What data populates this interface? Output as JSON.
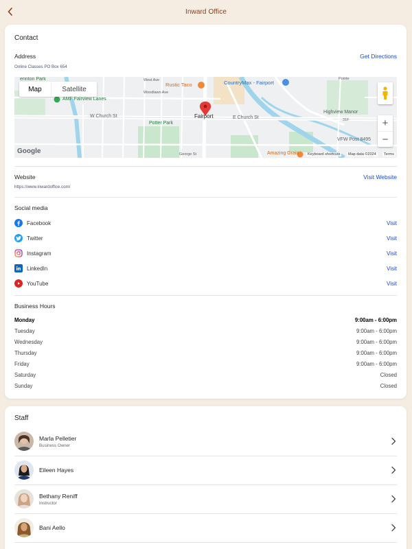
{
  "header": {
    "title": "Inward Office"
  },
  "contact": {
    "title": "Contact",
    "address": {
      "label": "Address",
      "value": "Online Classes PO Box 654",
      "action": "Get Directions"
    },
    "map": {
      "map_label": "Map",
      "satellite_label": "Satellite",
      "google": "Google",
      "keyboard_shortcuts": "Keyboard shortcuts",
      "map_data": "Map data ©2024",
      "terms": "Terms",
      "places": {
        "rustic_taco": "Rustic Taco",
        "countrymax": "CountryMax - Fairport",
        "amf": "AMF Fairview Lanes",
        "fairport": "Fairport",
        "highview_manor": "Highview Manor",
        "vfw": "VFW Post 8495",
        "amazing_grain": "Amazing Grain",
        "potter_park": "Potter Park",
        "brinton_park": "erinton Park",
        "w_church_st": "W Church St",
        "e_church_st": "E Church St",
        "west_ave": "West Ave",
        "woodlawn_ave": "Woodlawn Ave",
        "george_st": "George St",
        "route_31f": "31F",
        "pointe": "Pointe"
      }
    },
    "website": {
      "label": "Website",
      "value": "https://www.inwardoffice.com/",
      "action": "Visit Website"
    },
    "social": {
      "label": "Social media",
      "items": [
        {
          "name": "Facebook",
          "action": "Visit",
          "color": "#1877f2"
        },
        {
          "name": "Twitter",
          "action": "Visit",
          "color": "#1da1f2"
        },
        {
          "name": "Instagram",
          "action": "Visit",
          "color": "#e1306c"
        },
        {
          "name": "LinkedIn",
          "action": "Visit",
          "color": "#0a66c2"
        },
        {
          "name": "YouTube",
          "action": "Visit",
          "color": "#e02424"
        }
      ]
    },
    "hours": {
      "label": "Business Hours",
      "rows": [
        {
          "day": "Monday",
          "time": "9:00am - 6:00pm"
        },
        {
          "day": "Tuesday",
          "time": "9:00am - 6:00pm"
        },
        {
          "day": "Wednesday",
          "time": "9:00am - 6:00pm"
        },
        {
          "day": "Thursday",
          "time": "9:00am - 6:00pm"
        },
        {
          "day": "Friday",
          "time": "9:00am - 6:00pm"
        },
        {
          "day": "Saturday",
          "time": "Closed"
        },
        {
          "day": "Sunday",
          "time": "Closed"
        }
      ]
    }
  },
  "staff": {
    "title": "Staff",
    "members": [
      {
        "name": "Marla Pelletier",
        "role": "Business Owner"
      },
      {
        "name": "Eileen Hayes",
        "role": ""
      },
      {
        "name": "Bethany Reniff",
        "role": "Instructor"
      },
      {
        "name": "Bani Aello",
        "role": ""
      }
    ]
  },
  "colors": {
    "accent": "#8a3c16",
    "link": "#1a49c9",
    "background": "#f5ede2"
  }
}
